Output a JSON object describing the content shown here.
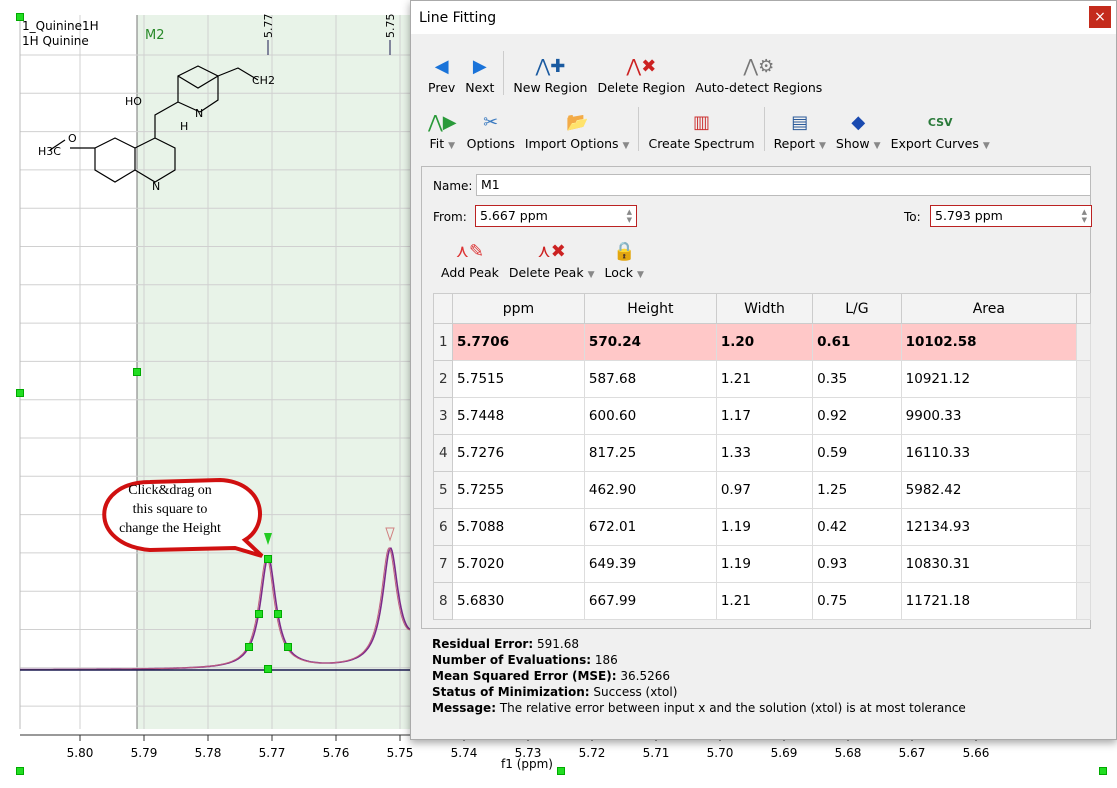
{
  "spectrum": {
    "title": "1_Quinine1H",
    "subtitle": "1H Quinine",
    "region_label": "M2",
    "peak_labels": [
      "5.77",
      "5.75"
    ],
    "xlabel": "f1 (ppm)",
    "x_ticks": [
      "5.80",
      "5.79",
      "5.78",
      "5.77",
      "5.76",
      "5.75",
      "5.74",
      "5.73",
      "5.72",
      "5.71",
      "5.70",
      "5.69",
      "5.68",
      "5.67",
      "5.66"
    ],
    "callout": [
      "Click&drag on",
      "this square to",
      "change the Height"
    ],
    "molecule": {
      "atoms": [
        "HO",
        "N",
        "H",
        "CH2",
        "H3C",
        "O",
        "N"
      ]
    },
    "colors": {
      "region": "#e8f3e8",
      "region_label": "#2a8a2a",
      "fit": "#7b2a8a",
      "handle": "#22dd22",
      "callout_border": "#d01010"
    }
  },
  "dialog": {
    "title": "Line Fitting",
    "close_icon": "×",
    "toolbar1": [
      {
        "label": "Prev",
        "icon": "arrow-left"
      },
      {
        "label": "Next",
        "icon": "arrow-right"
      },
      {
        "label": "New Region",
        "icon": "new-region"
      },
      {
        "label": "Delete Region",
        "icon": "delete-region"
      },
      {
        "label": "Auto-detect Regions",
        "icon": "auto-detect"
      }
    ],
    "toolbar2": [
      {
        "label": "Fit",
        "icon": "fit"
      },
      {
        "label": "Options",
        "icon": "tools"
      },
      {
        "label": "Import Options",
        "icon": "folder-import"
      },
      {
        "label": "Create Spectrum",
        "icon": "spectrum"
      },
      {
        "label": "Report",
        "icon": "report"
      },
      {
        "label": "Show",
        "icon": "highlighter"
      },
      {
        "label": "Export Curves",
        "icon": "csv"
      }
    ],
    "name_label": "Name:",
    "name_value": "M1",
    "from_label": "From:",
    "from_value": "5.667 ppm",
    "to_label": "To:",
    "to_value": "5.793 ppm",
    "peak_tools": [
      {
        "label": "Add Peak"
      },
      {
        "label": "Delete Peak"
      },
      {
        "label": "Lock"
      }
    ],
    "table": {
      "columns": [
        "ppm",
        "Height",
        "Width",
        "L/G",
        "Area"
      ],
      "rows": [
        [
          "1",
          "5.7706",
          "570.24",
          "1.20",
          "0.61",
          "10102.58"
        ],
        [
          "2",
          "5.7515",
          "587.68",
          "1.21",
          "0.35",
          "10921.12"
        ],
        [
          "3",
          "5.7448",
          "600.60",
          "1.17",
          "0.92",
          "9900.33"
        ],
        [
          "4",
          "5.7276",
          "817.25",
          "1.33",
          "0.59",
          "16110.33"
        ],
        [
          "5",
          "5.7255",
          "462.90",
          "0.97",
          "1.25",
          "5982.42"
        ],
        [
          "6",
          "5.7088",
          "672.01",
          "1.19",
          "0.42",
          "12134.93"
        ],
        [
          "7",
          "5.7020",
          "649.39",
          "1.19",
          "0.93",
          "10830.31"
        ],
        [
          "8",
          "5.6830",
          "667.99",
          "1.21",
          "0.75",
          "11721.18"
        ]
      ],
      "selected_row": 1,
      "selected_color": "#ffc8c8"
    },
    "stats": [
      {
        "k": "Residual Error:",
        "v": "591.68"
      },
      {
        "k": "Number of Evaluations:",
        "v": "186"
      },
      {
        "k": "Mean Squared Error (MSE):",
        "v": "36.5266"
      },
      {
        "k": "Status of Minimization:",
        "v": "Success (xtol)"
      },
      {
        "k": "Message:",
        "v": "The relative error between input x and the solution (xtol) is at most tolerance"
      }
    ]
  }
}
